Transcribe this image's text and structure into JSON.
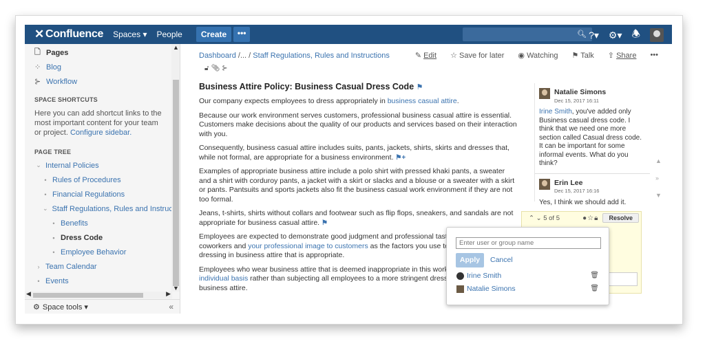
{
  "nav": {
    "logo": "Confluence",
    "spaces": "Spaces ▾",
    "people": "People",
    "create": "Create",
    "more": "•••",
    "help_icon": "?▾",
    "settings_icon": "⚙▾",
    "notifications_icon": "⇡"
  },
  "sidebar": {
    "pages": "Pages",
    "blog": "Blog",
    "workflow": "Workflow",
    "shortcuts_heading": "SPACE SHORTCUTS",
    "shortcuts_text": "Here you can add shortcut links to the most important content for your team or project.",
    "configure_link": "Configure sidebar.",
    "page_tree_heading": "PAGE TREE",
    "tree": [
      {
        "label": "Internal Policies",
        "bullet": "⌄"
      },
      {
        "label": "Rules of Procedures",
        "bullet": "•"
      },
      {
        "label": "Financial Regulations",
        "bullet": "•"
      },
      {
        "label": "Staff Regulations, Rules and Instructions",
        "bullet": "⌄"
      },
      {
        "label": "Benefits",
        "bullet": "•"
      },
      {
        "label": "Dress Code",
        "bullet": "•"
      },
      {
        "label": "Employee Behavior",
        "bullet": "•"
      },
      {
        "label": "Team Calendar",
        "bullet": "›"
      },
      {
        "label": "Events",
        "bullet": "•"
      }
    ],
    "space_tools": "Space tools ▾",
    "collapse": "«"
  },
  "breadcrumb": {
    "dashboard": "Dashboard",
    "ellipsis": "/... /",
    "current": "Staff Regulations, Rules and Instructions"
  },
  "actions": {
    "edit": "Edit",
    "save_later": "Save for later",
    "watching": "Watching",
    "talk": "Talk",
    "share": "Share",
    "more": "•••"
  },
  "page": {
    "title": "Business Attire Policy: Business Casual Dress Code",
    "p1_text": "Our company expects employees to dress appropriately in ",
    "p1_link": "business casual attire",
    "p1_end": ".",
    "p2": "Because our work environment serves customers, professional business casual attire is essential. Customers make decisions about the quality of our products and services based on their interaction with you.",
    "p3": "Consequently, business casual attire includes suits, pants, jackets, shirts, skirts and dresses that, while not formal, are appropriate for a business environment.",
    "p4": "Examples of appropriate business attire include a polo shirt with pressed khaki pants, a sweater and a shirt with corduroy pants, a jacket with a skirt or slacks and a blouse or a sweater with a skirt or pants. Pantsuits and sports jackets also fit the business casual work environment if they are not too formal.",
    "p5": "Jeans, t-shirts, shirts without collars and footwear such as flip flops, sneakers, and sandals are not appropriate for business casual attire.",
    "p6_a": "Employees are expected to demonstrate good judgment and professional taste. U",
    "p6_b": "coworkers and ",
    "p6_link": "your professional image to customers",
    "p6_c": " as the factors you use to as",
    "p6_d": "dressing in business attire that is appropriate.",
    "p7_a": "Employees who wear business attire that is deemed inappropriate in this workplac",
    "p7_link": "individual basis",
    "p7_b": " rather than subjecting all employees to a more stringent dress co",
    "p7_c": "business attire."
  },
  "comments": [
    {
      "author": "Natalie Simons",
      "date": "Dec 15, 2017 16:11",
      "mention": "Irine Smith",
      "text": ", you've added only Business casual dress code. I think that we need one more section called Casual dress code. It can be important for some informal events. What do you think?"
    },
    {
      "author": "Erin Lee",
      "date": "Dec 15, 2017 16:16",
      "text": "Yes, I think we should add it."
    }
  ],
  "inline_comment": {
    "counter": "5 of 5",
    "resolve": "Resolve"
  },
  "share_popup": {
    "placeholder": "Enter user or group name",
    "apply": "Apply",
    "cancel": "Cancel",
    "users": [
      "Irine Smith",
      "Natalie Simons"
    ]
  }
}
